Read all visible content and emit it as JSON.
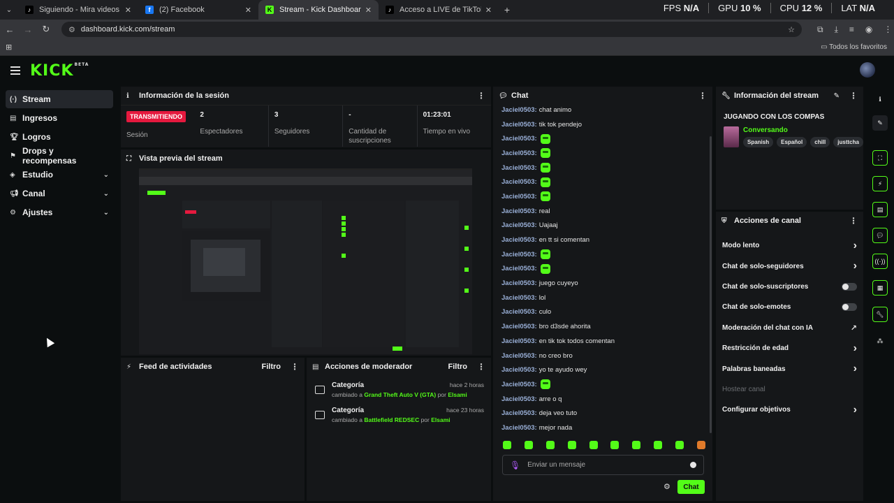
{
  "browser": {
    "tabs": [
      {
        "title": "Siguiendo - Mira videos publicados",
        "icon": "tiktok-icon",
        "active": false
      },
      {
        "title": "(2) Facebook",
        "icon": "facebook-icon",
        "active": false
      },
      {
        "title": "Stream - Kick Dashboard",
        "icon": "kick-icon",
        "active": true
      },
      {
        "title": "Acceso a LIVE de TikTok",
        "icon": "tiktok-icon",
        "active": false
      }
    ],
    "url": "dashboard.kick.com/stream",
    "bookmarks_label": "Todos los favoritos",
    "perf": [
      {
        "label": "FPS",
        "value": "N/A"
      },
      {
        "label": "GPU",
        "value": "10 %"
      },
      {
        "label": "CPU",
        "value": "12 %"
      },
      {
        "label": "LAT",
        "value": "N/A"
      }
    ]
  },
  "brand": {
    "logo": "KICK",
    "beta": "BETA",
    "accent": "#53fc18"
  },
  "sidebar": {
    "items": [
      {
        "label": "Stream",
        "icon": "broadcast-icon",
        "active": true,
        "expand": false
      },
      {
        "label": "Ingresos",
        "icon": "ledger-icon",
        "active": false,
        "expand": false
      },
      {
        "label": "Logros",
        "icon": "trophy-icon",
        "active": false,
        "expand": false
      },
      {
        "label": "Drops y recompensas",
        "icon": "drops-icon",
        "active": false,
        "expand": false
      },
      {
        "label": "Estudio",
        "icon": "studio-icon",
        "active": false,
        "expand": true
      },
      {
        "label": "Canal",
        "icon": "megaphone-icon",
        "active": false,
        "expand": true
      },
      {
        "label": "Ajustes",
        "icon": "gear-icon",
        "active": false,
        "expand": true
      }
    ]
  },
  "session": {
    "title": "Información de la sesión",
    "live_badge": "TRANSMITIENDO",
    "live_label": "Sesión",
    "stats": [
      {
        "value": "2",
        "label": "Espectadores"
      },
      {
        "value": "3",
        "label": "Seguidores"
      },
      {
        "value": "-",
        "label": "Cantidad de suscripciones"
      },
      {
        "value": "01:23:01",
        "label": "Tiempo en vivo"
      }
    ]
  },
  "preview": {
    "title": "Vista previa del stream"
  },
  "activity": {
    "title": "Feed de actividades",
    "filter": "Filtro"
  },
  "mod": {
    "title": "Acciones de moderador",
    "filter": "Filtro",
    "entries": [
      {
        "title": "Categoría",
        "prefix": "cambiado a",
        "game": "Grand Theft Auto V (GTA)",
        "by": "por",
        "user": "Elsami",
        "time": "hace 2 horas"
      },
      {
        "title": "Categoría",
        "prefix": "cambiado a",
        "game": "Battlefield REDSEC",
        "by": "por",
        "user": "Elsami",
        "time": "hace 23 horas"
      }
    ]
  },
  "chat": {
    "title": "Chat",
    "messages": [
      {
        "user": "Jaciel0503:",
        "text": "chat animo",
        "emote": false
      },
      {
        "user": "Jaciel0503:",
        "text": "tik tok pendejo",
        "emote": false
      },
      {
        "user": "Jaciel0503:",
        "text": "",
        "emote": true
      },
      {
        "user": "Jaciel0503:",
        "text": "",
        "emote": true
      },
      {
        "user": "Jaciel0503:",
        "text": "",
        "emote": true
      },
      {
        "user": "Jaciel0503:",
        "text": "",
        "emote": true
      },
      {
        "user": "Jaciel0503:",
        "text": "",
        "emote": true
      },
      {
        "user": "Jaciel0503:",
        "text": "real",
        "emote": false
      },
      {
        "user": "Jaciel0503:",
        "text": "Uajaaj",
        "emote": false
      },
      {
        "user": "Jaciel0503:",
        "text": "en tt si comentan",
        "emote": false
      },
      {
        "user": "Jaciel0503:",
        "text": "",
        "emote": true
      },
      {
        "user": "Jaciel0503:",
        "text": "",
        "emote": true
      },
      {
        "user": "Jaciel0503:",
        "text": "juego cuyeyo",
        "emote": false
      },
      {
        "user": "Jaciel0503:",
        "text": "lol",
        "emote": false
      },
      {
        "user": "Jaciel0503:",
        "text": "culo",
        "emote": false
      },
      {
        "user": "Jaciel0503:",
        "text": "bro d3sde ahorita",
        "emote": false
      },
      {
        "user": "Jaciel0503:",
        "text": "en tik tok todos comentan",
        "emote": false
      },
      {
        "user": "Jaciel0503:",
        "text": "no creo bro",
        "emote": false
      },
      {
        "user": "Jaciel0503:",
        "text": "yo te ayudo wey",
        "emote": false
      },
      {
        "user": "Jaciel0503:",
        "text": "",
        "emote": true
      },
      {
        "user": "Jaciel0503:",
        "text": "arre o q",
        "emote": false
      },
      {
        "user": "Jaciel0503:",
        "text": "deja veo tuto",
        "emote": false
      },
      {
        "user": "Jaciel0503:",
        "text": "mejor nada",
        "emote": false
      }
    ],
    "input_placeholder": "Enviar un mensaje",
    "send_label": "Chat"
  },
  "stream_info": {
    "title": "Información del stream",
    "stream_title": "JUGANDO CON LOS COMPAS",
    "category": "Conversando",
    "tags": [
      "Spanish",
      "Español",
      "chill",
      "justtcha"
    ]
  },
  "channel_actions": {
    "title": "Acciones de canal",
    "items": [
      {
        "label": "Modo lento",
        "control": "chevron",
        "disabled": false
      },
      {
        "label": "Chat de solo-seguidores",
        "control": "chevron",
        "disabled": false
      },
      {
        "label": "Chat de solo-suscriptores",
        "control": "toggle",
        "disabled": false
      },
      {
        "label": "Chat de solo-emotes",
        "control": "toggle",
        "disabled": false
      },
      {
        "label": "Moderación del chat con IA",
        "control": "external",
        "disabled": false
      },
      {
        "label": "Restricción de edad",
        "control": "chevron",
        "disabled": false
      },
      {
        "label": "Palabras baneadas",
        "control": "chevron",
        "disabled": false
      },
      {
        "label": "Hostear canal",
        "control": "none",
        "disabled": true
      },
      {
        "label": "Configurar objetivos",
        "control": "chevron",
        "disabled": false
      }
    ]
  }
}
